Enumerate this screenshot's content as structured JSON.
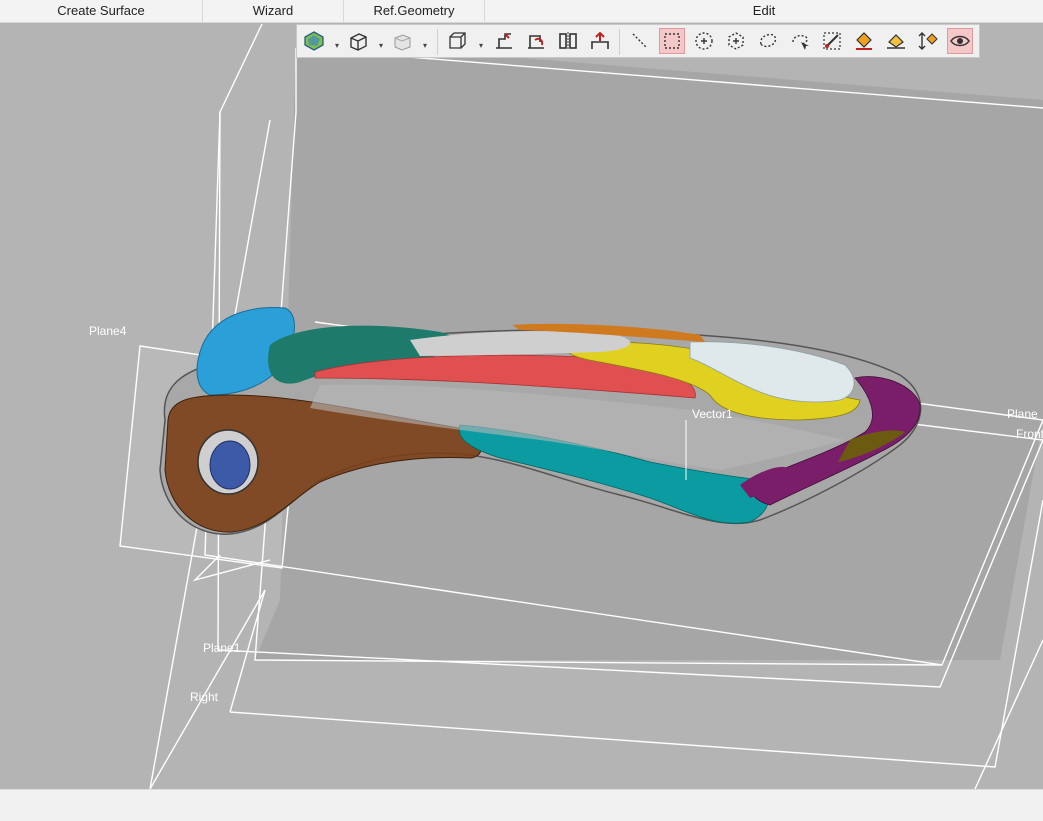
{
  "menubar": {
    "items": [
      {
        "label": "Create Surface"
      },
      {
        "label": "Wizard"
      },
      {
        "label": "Ref.Geometry"
      },
      {
        "label": "Edit"
      }
    ]
  },
  "toolbar": {
    "buttons": [
      {
        "icon": "view-style-icon",
        "dropdown": true
      },
      {
        "icon": "shaded-cube-icon",
        "dropdown": true
      },
      {
        "icon": "solid-box-icon",
        "dropdown": true
      },
      {
        "icon": "wireframe-cube-icon",
        "dropdown": true
      },
      {
        "icon": "align-plane-icon"
      },
      {
        "icon": "flip-plane-icon"
      },
      {
        "icon": "mirror-icon"
      },
      {
        "icon": "lift-icon"
      },
      {
        "icon": "line-select-icon"
      },
      {
        "icon": "rectangle-select-icon",
        "active": true
      },
      {
        "icon": "circle-select-icon"
      },
      {
        "icon": "polygon-select-icon"
      },
      {
        "icon": "lasso-select-icon"
      },
      {
        "icon": "freeform-select-icon"
      },
      {
        "icon": "paint-brush-select-icon"
      },
      {
        "icon": "fill-select-icon"
      },
      {
        "icon": "smart-select-icon"
      },
      {
        "icon": "extend-select-icon"
      },
      {
        "icon": "visibility-eye-icon",
        "active": true
      }
    ]
  },
  "viewport": {
    "labels": {
      "plane4": "Plane4",
      "vector1": "Vector1",
      "plane": "Plane",
      "front": "Front",
      "plane1": "Plane1",
      "right": "Right"
    },
    "background": "#b4b4b4",
    "region_colors": [
      "#2b9fd8",
      "#7a3f16",
      "#1e7a6a",
      "#e05050",
      "#e0d020",
      "#dfe8ea",
      "#0a9ca0",
      "#7a1e6a",
      "#d07a20",
      "#a9a9a9"
    ]
  }
}
